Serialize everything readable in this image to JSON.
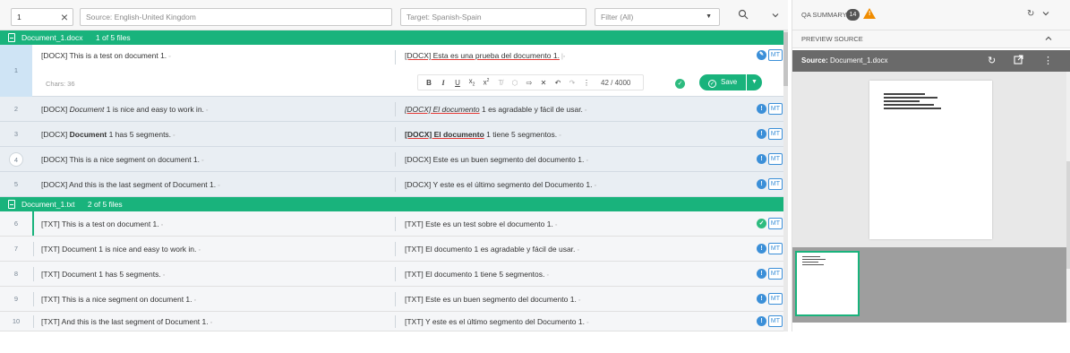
{
  "toolbar": {
    "segment_value": "1",
    "source_placeholder": "Source: English-United Kingdom",
    "target_placeholder": "Target: Spanish-Spain",
    "filter_value": "Filter (All)"
  },
  "files": [
    {
      "name": "Document_1.docx",
      "count": "1 of 5 files"
    },
    {
      "name": "Document_1.txt",
      "count": "2 of 5 files"
    }
  ],
  "active_segment": {
    "number": "1",
    "source": "[DOCX] This is a test on document 1.",
    "target": "[DOCX] Esta es una prueba del documento 1.",
    "chars": "Chars: 36",
    "char_count": "42 / 4000",
    "save_label": "Save",
    "status_tag": "MT"
  },
  "segments": [
    {
      "number": "2",
      "source_prefix": "[DOCX] ",
      "source_em": "Document",
      "source_rest": " 1 is nice and easy to work in.",
      "target_prefix": "",
      "target_em": "[DOCX] El documento",
      "target_rest": " 1 es agradable y fácil de usar.",
      "tag": "MT"
    },
    {
      "number": "3",
      "source_prefix": "[DOCX] ",
      "source_em": "Document",
      "source_rest": " 1 has 5 segments.",
      "target_prefix": "",
      "target_em": "[DOCX] El documento",
      "target_rest": " 1 tiene 5 segmentos.",
      "tag": "MT"
    },
    {
      "number": "4",
      "source_prefix": "[DOCX] This is a nice segment on document 1.",
      "source_em": "",
      "source_rest": "",
      "target_prefix": "[DOCX] Este es un buen segmento del documento 1.",
      "target_em": "",
      "target_rest": "",
      "tag": "MT"
    },
    {
      "number": "5",
      "source_prefix": "[DOCX] And this is the last segment of Document 1.",
      "source_em": "",
      "source_rest": "",
      "target_prefix": "[DOCX] Y este es el último segmento del Documento 1.",
      "target_em": "",
      "target_rest": "",
      "tag": "MT"
    },
    {
      "number": "6",
      "source_prefix": "[TXT] This is a test on document 1.",
      "source_em": "",
      "source_rest": "",
      "target_prefix": "[TXT] Este es un test sobre el documento 1.",
      "target_em": "",
      "target_rest": "",
      "tag": "MT"
    },
    {
      "number": "7",
      "source_prefix": "[TXT] Document 1 is nice and easy to work in.",
      "source_em": "",
      "source_rest": "",
      "target_prefix": "[TXT] El documento 1 es agradable y fácil de usar.",
      "target_em": "",
      "target_rest": "",
      "tag": "MT"
    },
    {
      "number": "8",
      "source_prefix": "[TXT] Document 1 has 5 segments.",
      "source_em": "",
      "source_rest": "",
      "target_prefix": "[TXT] El documento 1 tiene 5 segmentos.",
      "target_em": "",
      "target_rest": "",
      "tag": "MT"
    },
    {
      "number": "9",
      "source_prefix": "[TXT] This is a nice segment on document 1.",
      "source_em": "",
      "source_rest": "",
      "target_prefix": "[TXT] Este es un buen segmento del documento 1.",
      "target_em": "",
      "target_rest": "",
      "tag": "MT"
    },
    {
      "number": "10",
      "source_prefix": "[TXT] And this is the last segment of Document 1.",
      "source_em": "",
      "source_rest": "",
      "target_prefix": "[TXT] Y este es el último segmento del Documento 1.",
      "target_em": "",
      "target_rest": "",
      "tag": "MT"
    }
  ],
  "right_panel": {
    "qa_label": "QA SUMMARY",
    "qa_count": "14",
    "preview_label": "PREVIEW SOURCE",
    "source_prefix": "Source:",
    "source_file": "Document_1.docx"
  },
  "colors": {
    "accent_green": "#19b37c",
    "info_blue": "#3b8fd8",
    "warning_orange": "#f08c00"
  }
}
